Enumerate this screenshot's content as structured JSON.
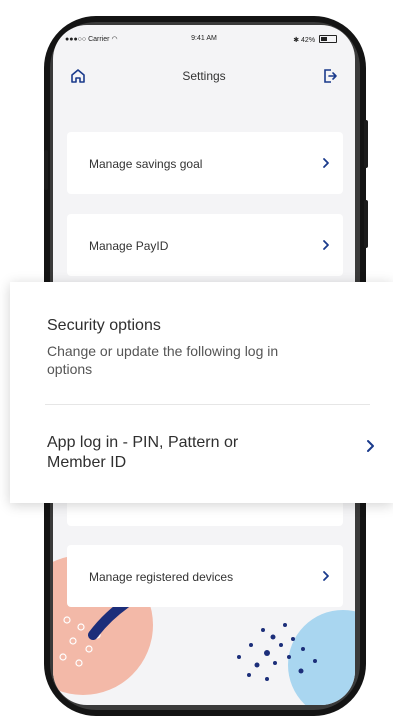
{
  "status_bar": {
    "carrier": "Carrier",
    "time": "9:41 AM",
    "battery": "42%"
  },
  "nav": {
    "title": "Settings",
    "left_icon": "home-icon",
    "right_icon": "logout-icon"
  },
  "menu": [
    {
      "label": "Manage savings goal"
    },
    {
      "label": "Manage PayID"
    },
    {
      "label": "Manage registered devices"
    }
  ],
  "security_panel": {
    "title": "Security options",
    "subtitle": "Change or update the following log in options",
    "option": "App log in - PIN, Pattern or Member ID"
  },
  "colors": {
    "accent": "#1a3a8c",
    "screen_bg": "#f4f4f6",
    "deco_peach": "#f3b9a8",
    "deco_navy": "#1c2e7a",
    "deco_blue": "#a9d6f0"
  }
}
